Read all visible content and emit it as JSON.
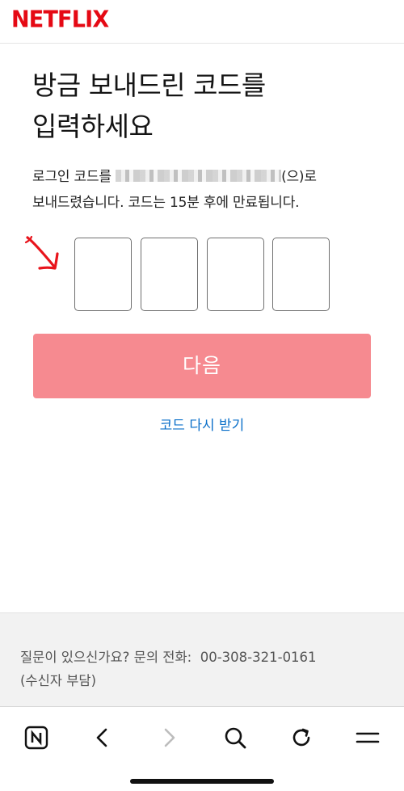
{
  "header": {
    "logo_text": "NETFLIX",
    "brand_color": "#E50914"
  },
  "main": {
    "title_line1": "방금 보내드린 코드를",
    "title_line2": "입력하세요",
    "desc_prefix": "로그인 코드를 ",
    "desc_suffix": "(으)로",
    "desc_line2": "보내드렸습니다. 코드는 15분 후에 만료됩니다.",
    "code_boxes": [
      "",
      "",
      "",
      ""
    ],
    "next_button_label": "다음",
    "next_button_color": "#F68A90",
    "resend_link_label": "코드 다시 받기",
    "link_color": "#0A6FC9"
  },
  "annotation": {
    "arrow_icon": "red-arrow-icon",
    "arrow_color": "#E8141C"
  },
  "footer": {
    "question_text": "질문이 있으신가요? 문의 전화:",
    "phone": "00-308-321-0161",
    "toll_note": "(수신자 부담)"
  },
  "toolbar": {
    "items": [
      "naver-home-icon",
      "back-icon",
      "forward-icon",
      "search-icon",
      "refresh-icon",
      "menu-icon"
    ]
  }
}
